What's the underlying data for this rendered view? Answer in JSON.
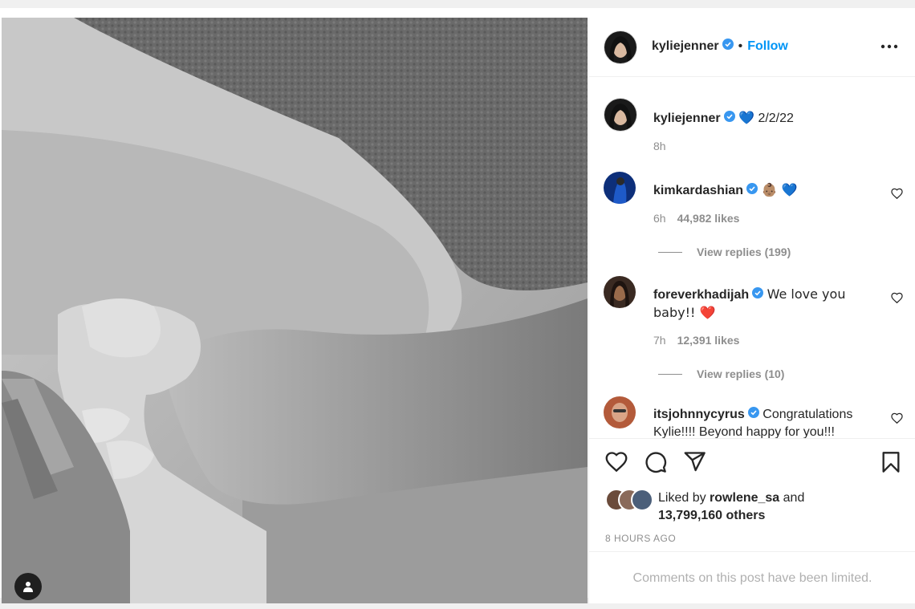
{
  "post": {
    "author": "kyliejenner",
    "follow_label": "Follow",
    "dot": "•"
  },
  "caption": {
    "user": "kyliejenner",
    "emoji": "💙",
    "text": "2/2/22",
    "time": "8h"
  },
  "comments": [
    {
      "user": "kimkardashian",
      "text": "👶🏽 💙",
      "time": "6h",
      "likes": "44,982 likes",
      "replies": "View replies (199)"
    },
    {
      "user": "foreverkhadijah",
      "text": "We love you baby!! ❤️",
      "time": "7h",
      "likes": "12,391 likes",
      "replies": "View replies (10)"
    },
    {
      "user": "itsjohnnycyrus",
      "text": "Congratulations Kylie!!!! Beyond happy for you!!!"
    }
  ],
  "liked_by": {
    "prefix": "Liked by ",
    "user": "rowlene_sa",
    "and": " and",
    "others": "13,799,160 others"
  },
  "posted_ago": "8 HOURS AGO",
  "comments_limited": "Comments on this post have been limited.",
  "colors": {
    "accent": "#0095f6",
    "verified": "#3897f0",
    "text": "#262626",
    "muted": "#8e8e8e"
  },
  "icons": [
    "person-tag-icon",
    "more-options-icon",
    "verified-badge-icon",
    "heart-icon",
    "comment-icon",
    "share-icon",
    "bookmark-icon"
  ]
}
